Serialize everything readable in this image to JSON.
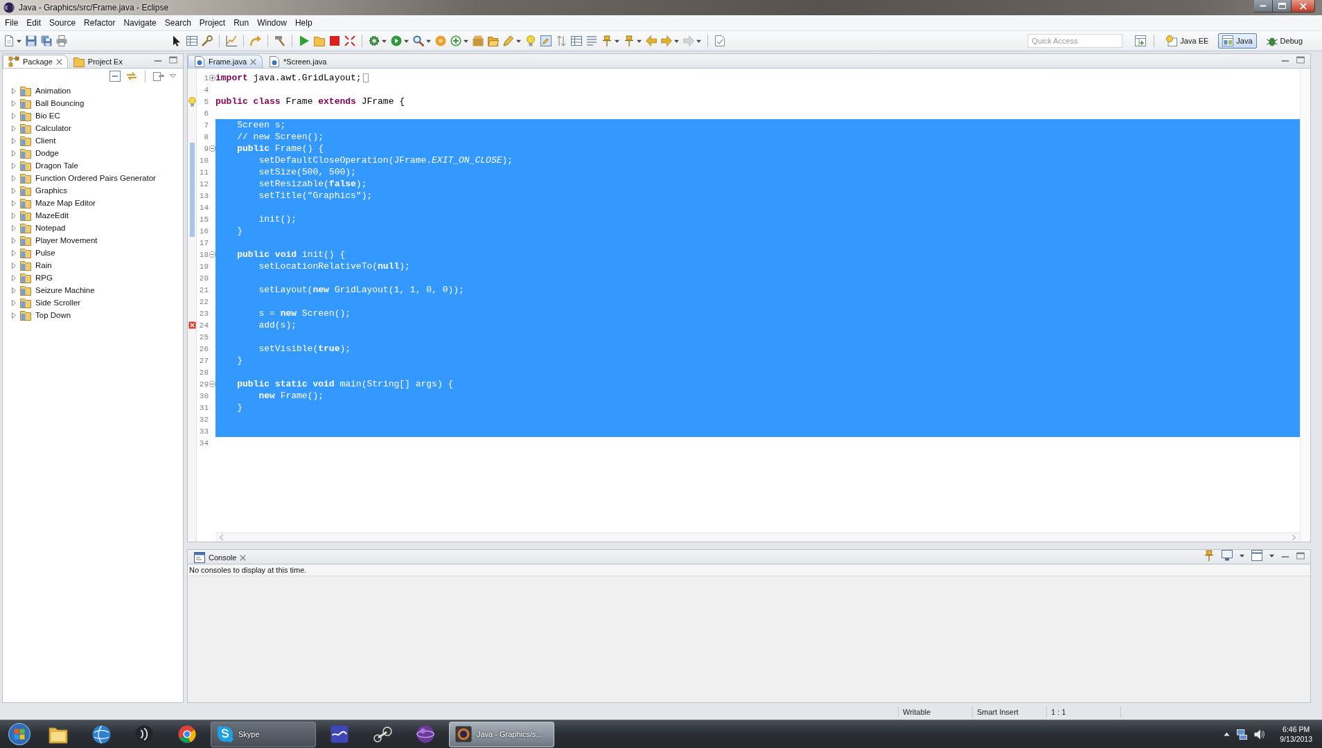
{
  "window": {
    "title": "Java - Graphics/src/Frame.java - Eclipse"
  },
  "menu": [
    "File",
    "Edit",
    "Source",
    "Refactor",
    "Navigate",
    "Search",
    "Project",
    "Run",
    "Window",
    "Help"
  ],
  "toolbar": {
    "highlight_toggle": {
      "on": true
    },
    "quick_access": {
      "placeholder": "Quick Access"
    },
    "perspectives": [
      {
        "label": "Java EE",
        "selected": false
      },
      {
        "label": "Java",
        "selected": true
      },
      {
        "label": "Debug",
        "selected": false
      }
    ]
  },
  "package_explorer": {
    "tabs": [
      {
        "label": "Package",
        "selected": true
      },
      {
        "label": "Project Ex",
        "selected": false
      }
    ],
    "projects": [
      "Animation",
      "Ball Bouncing",
      "Bio EC",
      "Calculator",
      "Client",
      "Dodge",
      "Dragon Tale",
      "Function Ordered Pairs Generator",
      "Graphics",
      "Maze Map Editor",
      "MazeEdit",
      "Notepad",
      "Player Movement",
      "Pulse",
      "Rain",
      "RPG",
      "Seizure Machine",
      "Side Scroller",
      "Top Down"
    ]
  },
  "editor": {
    "tabs": [
      {
        "label": "Frame.java",
        "selected": true
      },
      {
        "label": "*Screen.java",
        "selected": false
      }
    ],
    "lines": [
      {
        "number": "1",
        "text": "**import** java.awt.GridLayout;",
        "selected": false,
        "in_scope": false,
        "fold": {
          "expanded": false
        }
      },
      {
        "number": "4",
        "selected": false,
        "in_scope": false
      },
      {
        "number": "5",
        "text": "**public class** Frame **extends** JFrame {",
        "selected": false,
        "in_scope": false,
        "marker": {
          "kind": "warning"
        }
      },
      {
        "number": "6",
        "selected": false,
        "in_scope": false
      },
      {
        "number": "7",
        "text": "    Screen s;",
        "selected": true,
        "in_scope": false
      },
      {
        "number": "8",
        "text": "    // new Screen();",
        "selected": true,
        "in_scope": false
      },
      {
        "number": "9",
        "text": "    **public** Frame() {",
        "selected": true,
        "in_scope": true,
        "fold": {
          "expanded": true
        }
      },
      {
        "number": "10",
        "text": "        setDefaultCloseOperation(JFrame.*EXIT_ON_CLOSE*);",
        "selected": true,
        "in_scope": true
      },
      {
        "number": "11",
        "text": "        setSize(500, 500);",
        "selected": true,
        "in_scope": true
      },
      {
        "number": "12",
        "text": "        setResizable(**false**);",
        "selected": true,
        "in_scope": true
      },
      {
        "number": "13",
        "text": "        setTitle(\"Graphics\");",
        "selected": true,
        "in_scope": true
      },
      {
        "number": "14",
        "selected": true,
        "in_scope": true
      },
      {
        "number": "15",
        "text": "        init();",
        "selected": true,
        "in_scope": true
      },
      {
        "number": "16",
        "text": "    }",
        "selected": true,
        "in_scope": true
      },
      {
        "number": "17",
        "selected": true,
        "in_scope": false
      },
      {
        "number": "18",
        "text": "    **public void** init() {",
        "selected": true,
        "in_scope": false,
        "fold": {
          "expanded": true
        }
      },
      {
        "number": "19",
        "text": "        setLocationRelativeTo(**null**);",
        "selected": true,
        "in_scope": false
      },
      {
        "number": "20",
        "selected": true,
        "in_scope": false
      },
      {
        "number": "21",
        "text": "        setLayout(**new** GridLayout(1, 1, 0, 0));",
        "selected": true,
        "in_scope": false
      },
      {
        "number": "22",
        "selected": true,
        "in_scope": false
      },
      {
        "number": "23",
        "text": "        s = **new** Screen();",
        "selected": true,
        "in_scope": false
      },
      {
        "number": "24",
        "text": "        add(s);",
        "selected": true,
        "in_scope": false,
        "marker": {
          "kind": "error"
        }
      },
      {
        "number": "25",
        "selected": true,
        "in_scope": false
      },
      {
        "number": "26",
        "text": "        setVisible(**true**);",
        "selected": true,
        "in_scope": false
      },
      {
        "number": "27",
        "text": "    }",
        "selected": true,
        "in_scope": false
      },
      {
        "number": "28",
        "selected": true,
        "in_scope": false
      },
      {
        "number": "29",
        "text": "    **public static void** main(String[] args) {",
        "selected": true,
        "in_scope": false,
        "fold": {
          "expanded": true
        }
      },
      {
        "number": "30",
        "text": "        **new** Frame();",
        "selected": true,
        "in_scope": false
      },
      {
        "number": "31",
        "text": "    }",
        "selected": true,
        "in_scope": false
      },
      {
        "number": "32",
        "selected": true,
        "in_scope": false
      },
      {
        "number": "33",
        "selected": true,
        "in_scope": false
      },
      {
        "number": "34",
        "selected": false,
        "in_scope": false
      }
    ]
  },
  "console": {
    "title": "Console",
    "message": "No consoles to display at this time."
  },
  "status_bar": [
    "Writable",
    "Smart Insert",
    "1 : 1"
  ],
  "taskbar": {
    "windows": [
      {
        "label": "Skype",
        "active": false
      },
      {
        "label": "Java - Graphics/s...",
        "active": true
      }
    ],
    "clock": {
      "time": "6:46 PM",
      "date": "9/13/2013"
    }
  }
}
